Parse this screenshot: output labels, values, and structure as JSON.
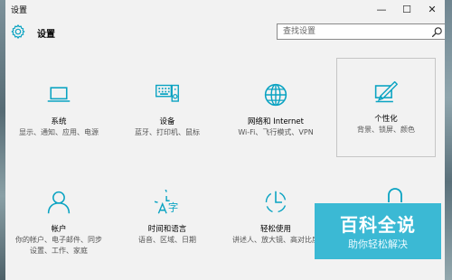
{
  "window": {
    "title": "设置",
    "controls": {
      "minimize": "—",
      "maximize": "☐",
      "close": "✕"
    }
  },
  "header": {
    "title": "设置",
    "search_placeholder": "查找设置"
  },
  "categories": [
    {
      "title": "系统",
      "subtitle": "显示、通知、应用、电源",
      "icon": "laptop-icon"
    },
    {
      "title": "设备",
      "subtitle": "蓝牙、打印机、鼠标",
      "icon": "keyboard-icon"
    },
    {
      "title": "网络和 Internet",
      "subtitle": "Wi-Fi、飞行模式、VPN",
      "icon": "globe-icon"
    },
    {
      "title": "个性化",
      "subtitle": "背景、锁屏、颜色",
      "icon": "paint-icon"
    },
    {
      "title": "帐户",
      "subtitle": "你的帐户、电子邮件、同步设置、工作、家庭",
      "icon": "person-icon"
    },
    {
      "title": "时间和语言",
      "subtitle": "语音、区域、日期",
      "icon": "time-language-icon"
    },
    {
      "title": "轻松使用",
      "subtitle": "讲述人、放大镜、高对比度",
      "icon": "ease-of-access-icon"
    }
  ],
  "watermark": {
    "title": "百科全说",
    "subtitle": "助你轻松解决"
  },
  "colors": {
    "accent": "#0aa3c2",
    "watermark": "#3bb9d4"
  }
}
